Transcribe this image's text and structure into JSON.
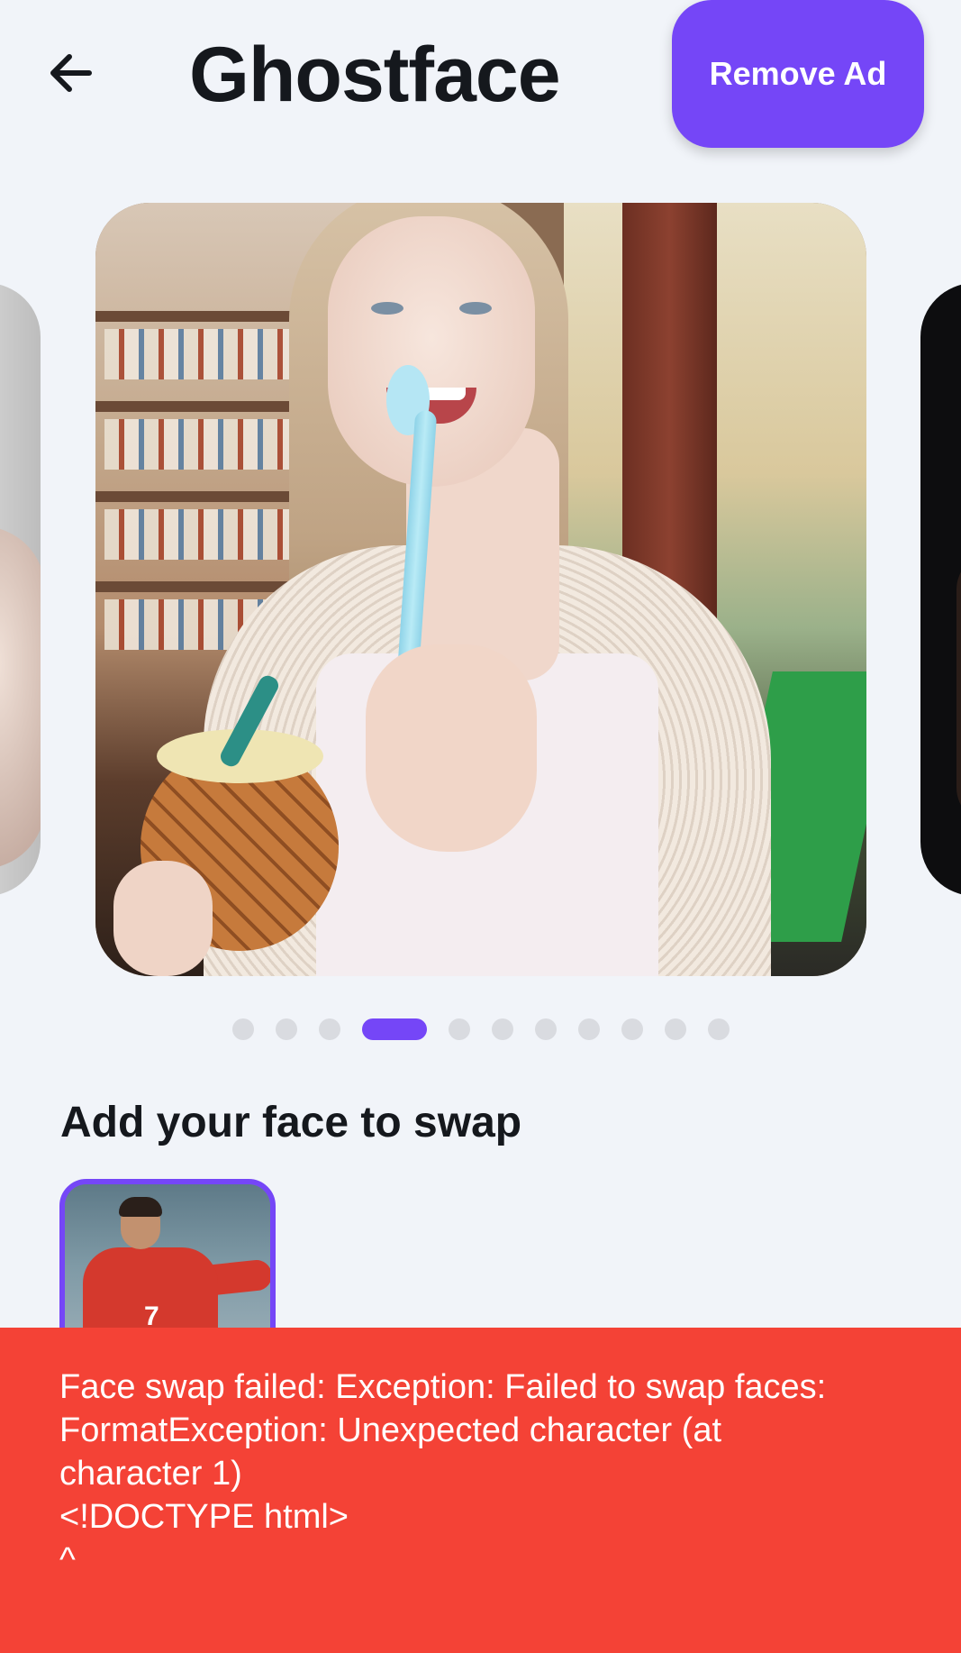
{
  "header": {
    "title": "Ghostface",
    "remove_ad_label": "Remove Ad",
    "back_icon": "arrow-left-icon"
  },
  "carousel": {
    "total_dots": 11,
    "active_index": 3,
    "active_color": "#7546f7",
    "inactive_color": "#d9dbe0"
  },
  "face_section": {
    "title": "Add your face to swap",
    "selected_border_color": "#7546f7",
    "thumb_number": "7"
  },
  "snackbar": {
    "message": "Face swap failed: Exception: Failed to swap faces:\nFormatException: Unexpected character (at\ncharacter 1)\n<!DOCTYPE html>\n^",
    "background_color": "#f44236"
  },
  "colors": {
    "accent": "#7546f7",
    "background": "#f1f4f9",
    "error": "#f44236"
  }
}
